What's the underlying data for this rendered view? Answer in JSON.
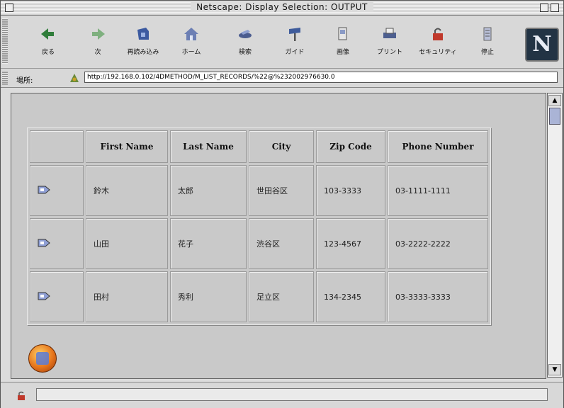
{
  "window": {
    "title": "Netscape: Display Selection: OUTPUT"
  },
  "toolbar": {
    "buttons": [
      {
        "label": "戻る",
        "icon": "back-arrow-icon"
      },
      {
        "label": "次",
        "icon": "forward-arrow-icon"
      },
      {
        "label": "再読み込み",
        "icon": "reload-icon"
      },
      {
        "label": "ホーム",
        "icon": "home-icon"
      },
      {
        "label": "検索",
        "icon": "search-icon"
      },
      {
        "label": "ガイド",
        "icon": "guide-icon"
      },
      {
        "label": "画像",
        "icon": "images-icon"
      },
      {
        "label": "プリント",
        "icon": "print-icon"
      },
      {
        "label": "セキュリティ",
        "icon": "security-icon"
      },
      {
        "label": "停止",
        "icon": "stop-icon"
      }
    ],
    "logo_letter": "N"
  },
  "location": {
    "label": "場所:",
    "url": "http://192.168.0.102/4DMETHOD/M_LIST_RECORDS/%22@%232002976630.0"
  },
  "table": {
    "headers": [
      "",
      "First Name",
      "Last Name",
      "City",
      "Zip Code",
      "Phone Number"
    ],
    "rows": [
      {
        "first": "鈴木",
        "last": "太郎",
        "city": "世田谷区",
        "zip": "103-3333",
        "phone": "03-1111-1111"
      },
      {
        "first": "山田",
        "last": "花子",
        "city": "渋谷区",
        "zip": "123-4567",
        "phone": "03-2222-2222"
      },
      {
        "first": "田村",
        "last": "秀利",
        "city": "足立区",
        "zip": "134-2345",
        "phone": "03-3333-3333"
      }
    ]
  },
  "status": {
    "text": ""
  },
  "colors": {
    "content_bg": "#c9c9c9",
    "chrome_bg": "#d8d8d8",
    "logo_bg": "#223344"
  }
}
